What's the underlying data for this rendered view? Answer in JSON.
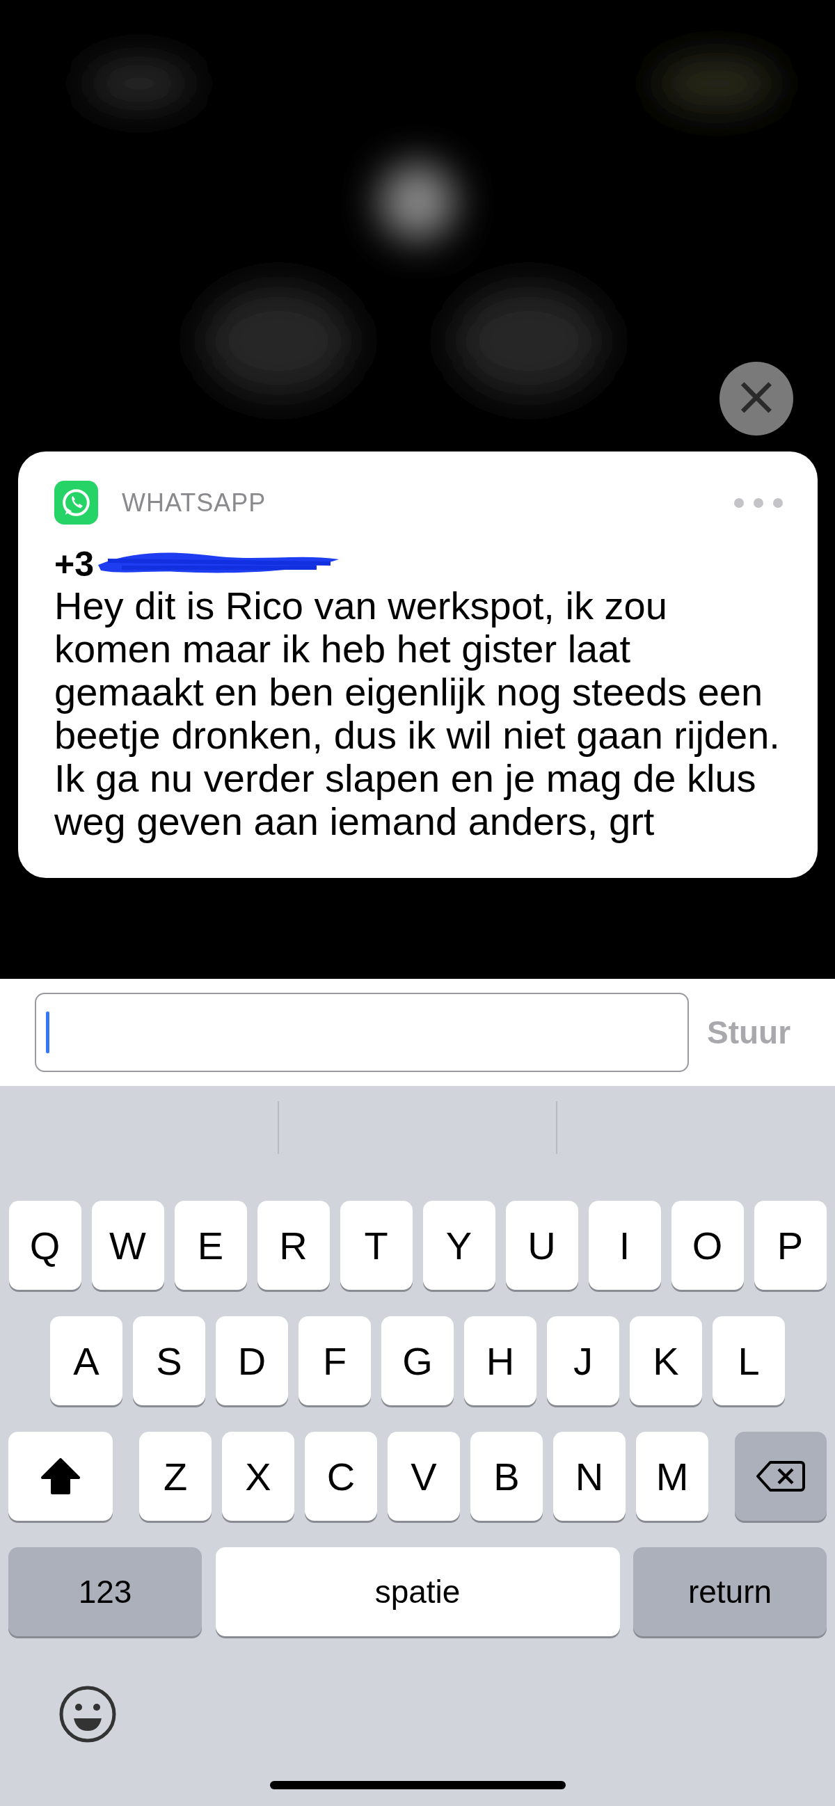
{
  "close_button": {
    "label": "×"
  },
  "notification": {
    "app": "WHATSAPP",
    "sender": "+3",
    "sender_redacted": true,
    "message": "Hey dit is Rico van werkspot, ik zou komen maar ik heb het gister laat gemaakt en ben eigenlijk nog steeds een beetje dronken, dus ik wil niet gaan rijden. Ik ga nu verder slapen en je mag de klus weg geven aan iemand anders, grt"
  },
  "reply": {
    "send_label": "Stuur",
    "send_disabled": true,
    "focused": true
  },
  "keyboard": {
    "rows": [
      {
        "keys": [
          {
            "kind": "letter",
            "label": "Q"
          },
          {
            "kind": "letter",
            "label": "W"
          },
          {
            "kind": "letter",
            "label": "E"
          },
          {
            "kind": "letter",
            "label": "R"
          },
          {
            "kind": "letter",
            "label": "T"
          },
          {
            "kind": "letter",
            "label": "Y"
          },
          {
            "kind": "letter",
            "label": "U"
          },
          {
            "kind": "letter",
            "label": "I"
          },
          {
            "kind": "letter",
            "label": "O"
          },
          {
            "kind": "letter",
            "label": "P"
          }
        ]
      },
      {
        "keys": [
          {
            "kind": "letter",
            "label": "A"
          },
          {
            "kind": "letter",
            "label": "S"
          },
          {
            "kind": "letter",
            "label": "D"
          },
          {
            "kind": "letter",
            "label": "F"
          },
          {
            "kind": "letter",
            "label": "G"
          },
          {
            "kind": "letter",
            "label": "H"
          },
          {
            "kind": "letter",
            "label": "J"
          },
          {
            "kind": "letter",
            "label": "K"
          },
          {
            "kind": "letter",
            "label": "L"
          }
        ]
      },
      {
        "keys": [
          {
            "kind": "shift",
            "on": true
          },
          {
            "kind": "letter",
            "label": "Z"
          },
          {
            "kind": "letter",
            "label": "X"
          },
          {
            "kind": "letter",
            "label": "C"
          },
          {
            "kind": "letter",
            "label": "V"
          },
          {
            "kind": "letter",
            "label": "B"
          },
          {
            "kind": "letter",
            "label": "N"
          },
          {
            "kind": "letter",
            "label": "M"
          },
          {
            "kind": "backspace"
          }
        ]
      },
      {
        "keys": [
          {
            "kind": "mode",
            "label": "123"
          },
          {
            "kind": "space",
            "label": "spatie"
          },
          {
            "kind": "return",
            "label": "return"
          }
        ]
      }
    ]
  }
}
